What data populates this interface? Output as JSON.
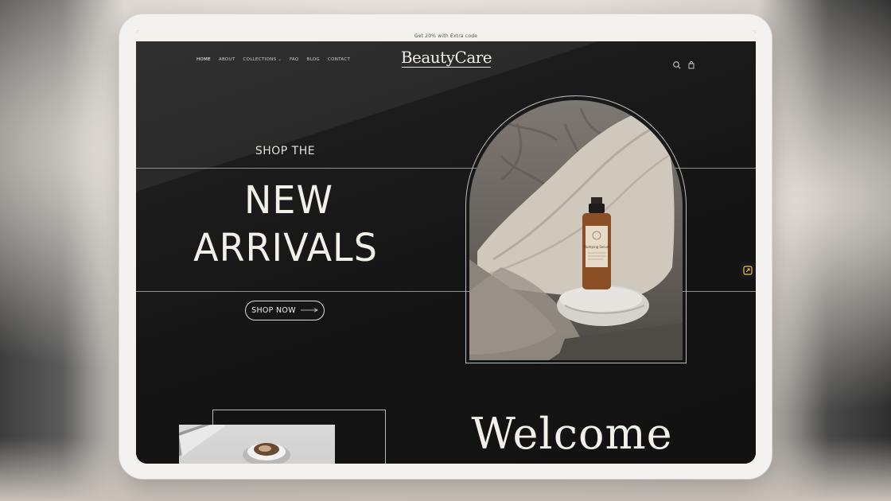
{
  "announcement": "Get 20% with Extra code",
  "brand": {
    "logo_text": "BeautyCare"
  },
  "nav": {
    "items": [
      {
        "label": "HOME",
        "active": true
      },
      {
        "label": "ABOUT"
      },
      {
        "label": "COLLECTIONS",
        "has_dropdown": true
      },
      {
        "label": "FAQ"
      },
      {
        "label": "BLOG"
      },
      {
        "label": "CONTACT"
      }
    ]
  },
  "header_icons": [
    "search-icon",
    "cart-icon"
  ],
  "hero": {
    "eyebrow": "SHOP THE",
    "title_line1": "NEW",
    "title_line2": "ARRIVALS",
    "cta_label": "SHOP NOW",
    "image_icon": "serum-bottle-on-stone",
    "bottle_label": "Plumping Serum"
  },
  "side_button_icon": "promo-icon",
  "welcome": {
    "heading": "Welcome"
  },
  "colors": {
    "background_dark": "#202020",
    "text_light": "#f3f0ea",
    "announcement_bar": "#f4f1ec",
    "line": "#8f8f8f"
  }
}
